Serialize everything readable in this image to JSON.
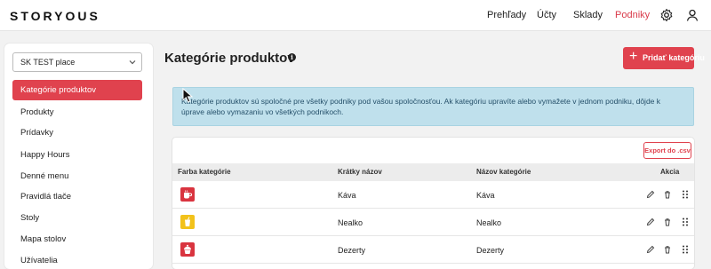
{
  "header": {
    "logo": "STORYOUS",
    "nav": [
      {
        "label": "Prehľady",
        "active": false
      },
      {
        "label": "Účty",
        "active": false
      },
      {
        "label": "Sklady",
        "active": false
      },
      {
        "label": "Podniky",
        "active": true
      }
    ],
    "settings_icon": "gear-icon",
    "user_icon": "user-icon"
  },
  "sidebar": {
    "place_select": {
      "value": "SK TEST place"
    },
    "items": [
      {
        "label": "Kategórie produktov",
        "active": true
      },
      {
        "label": "Produkty"
      },
      {
        "label": "Prídavky"
      },
      {
        "label": "Happy Hours"
      },
      {
        "label": "Denné menu"
      },
      {
        "label": "Pravidlá tlače"
      },
      {
        "label": "Stoly"
      },
      {
        "label": "Mapa stolov"
      },
      {
        "label": "Užívatelia"
      }
    ]
  },
  "main": {
    "title": "Kategórie produktov",
    "add_button": "Pridať kategóriu",
    "info_text": "Kategórie produktov sú spoločné pre všetky podniky pod vašou spoločnosťou. Ak kategóriu upravíte alebo vymažete v jednom podniku, dôjde k úprave alebo vymazaniu vo všetkých podnikoch.",
    "export_button": "Export do .csv",
    "table": {
      "columns": [
        "Farba kategórie",
        "Krátky názov",
        "Názov kategórie",
        "Akcia"
      ],
      "rows": [
        {
          "color": "#d9343f",
          "icon": "coffee-cup-icon",
          "short_name": "Káva",
          "name": "Káva"
        },
        {
          "color": "#f2c21b",
          "icon": "soda-cup-icon",
          "short_name": "Nealko",
          "name": "Nealko"
        },
        {
          "color": "#d9343f",
          "icon": "cupcake-icon",
          "short_name": "Dezerty",
          "name": "Dezerty"
        }
      ]
    }
  },
  "colors": {
    "accent": "#e0424e",
    "info_bg": "#bfe0ec",
    "table_header_bg": "#ececec"
  }
}
